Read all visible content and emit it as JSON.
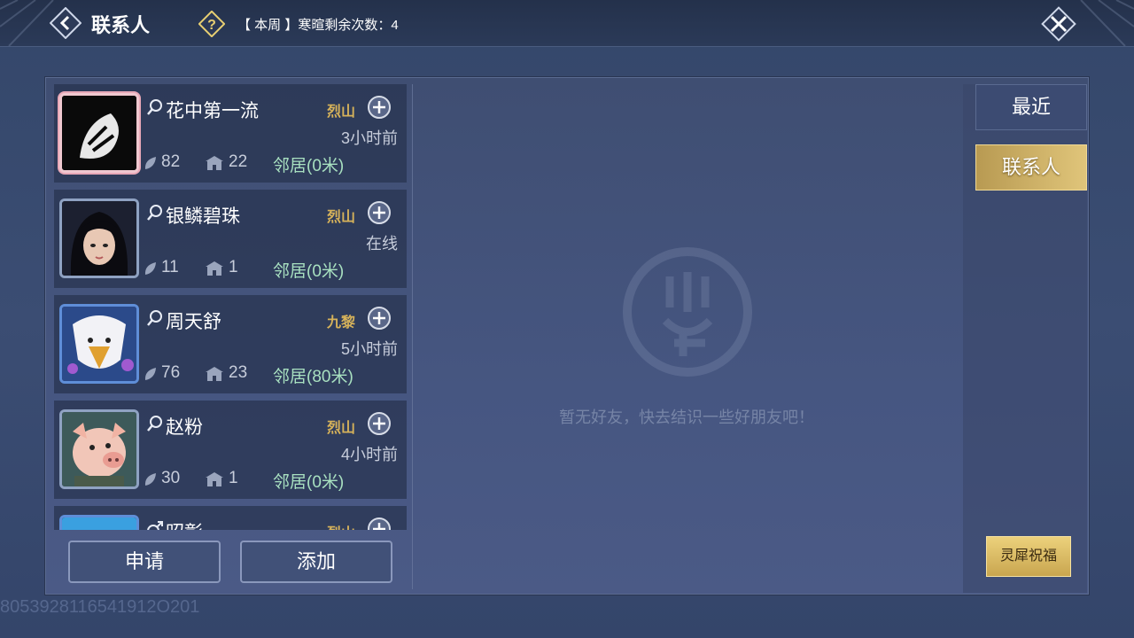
{
  "header": {
    "title": "联系人",
    "weekly_text": "【 本周 】寒暄剩余次数：4"
  },
  "contacts": [
    {
      "name": "花中第一流",
      "school": "烈山",
      "last_seen": "3小时前",
      "stat1": "82",
      "stat2": "22",
      "neighbor": "邻居(0米)"
    },
    {
      "name": "银鳞碧珠",
      "school": "烈山",
      "last_seen": "在线",
      "stat1": "11",
      "stat2": "1",
      "neighbor": "邻居(0米)"
    },
    {
      "name": "周天舒",
      "school": "九黎",
      "last_seen": "5小时前",
      "stat1": "76",
      "stat2": "23",
      "neighbor": "邻居(80米)"
    },
    {
      "name": "赵粉",
      "school": "烈山",
      "last_seen": "4小时前",
      "stat1": "30",
      "stat2": "1",
      "neighbor": "邻居(0米)"
    },
    {
      "name": "昭彰",
      "school": "烈山",
      "last_seen": "",
      "stat1": "",
      "stat2": "",
      "neighbor": ""
    }
  ],
  "buttons": {
    "apply": "申请",
    "add": "添加"
  },
  "empty_state": {
    "text": "暂无好友，快去结识一些好朋友吧！"
  },
  "tabs": {
    "recent": "最近",
    "contacts": "联系人"
  },
  "bless_button": "灵犀祝福",
  "uid": "8053928116541912O201",
  "icons": [
    "back-icon",
    "help-icon",
    "close-icon",
    "search-gender-icon",
    "add-friend-icon",
    "leaf-icon",
    "house-icon",
    "empty-logo-icon"
  ],
  "colors": {
    "accent_gold": "#d6b25a",
    "neighbor_green": "#a8e0c0",
    "tab_active": "#e0c57a"
  }
}
